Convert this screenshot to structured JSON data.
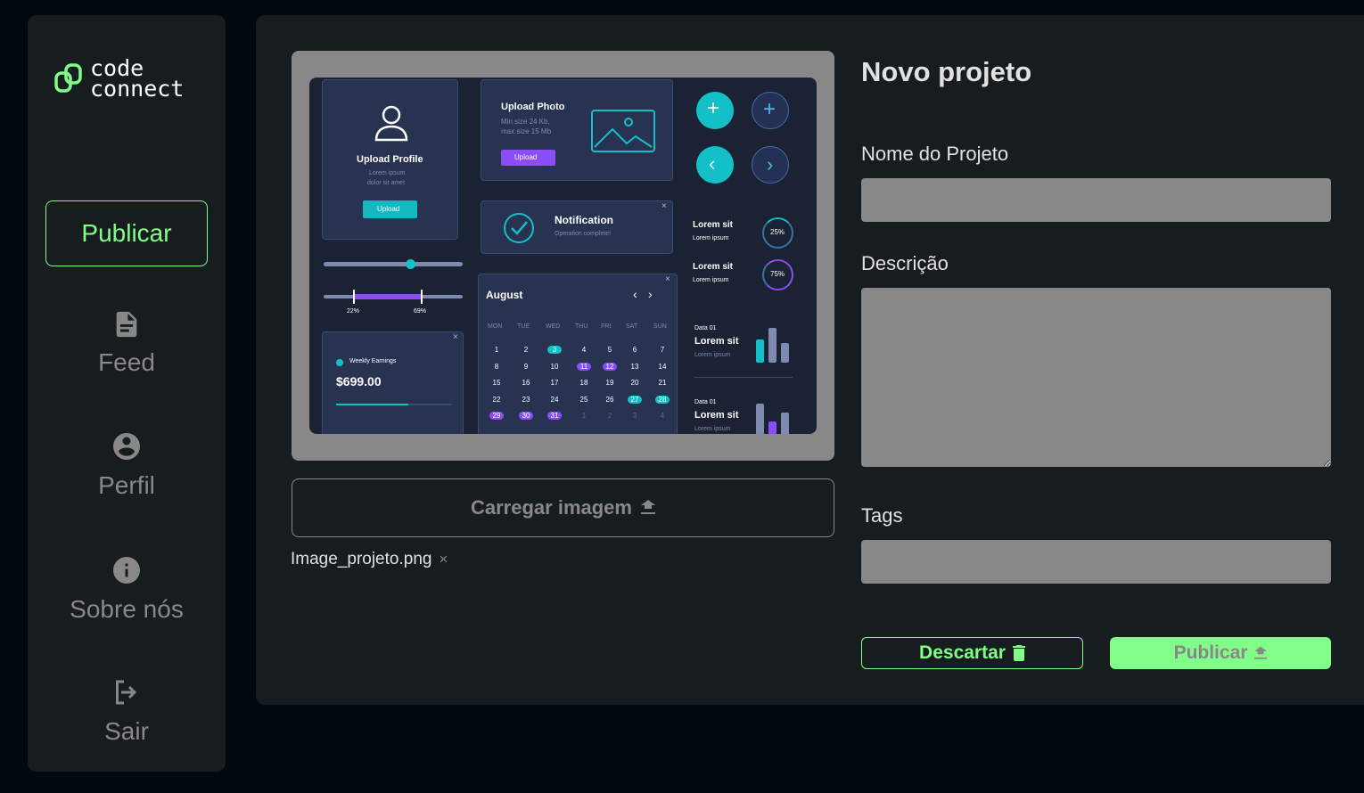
{
  "sidebar": {
    "logo": {
      "line1": "code",
      "line2": "connect"
    },
    "publish_label": "Publicar",
    "items": [
      {
        "label": "Feed",
        "icon": "document-icon"
      },
      {
        "label": "Perfil",
        "icon": "account-icon"
      },
      {
        "label": "Sobre nós",
        "icon": "info-icon"
      },
      {
        "label": "Sair",
        "icon": "logout-icon"
      }
    ]
  },
  "upload": {
    "button_label": "Carregar imagem",
    "file_name": "Image_projeto.png",
    "remove_symbol": "×"
  },
  "preview": {
    "upload_profile": {
      "title": "Upload Profile",
      "sub1": "Lorem ipsum",
      "sub2": "dolor sit amet",
      "button": "Upload"
    },
    "upload_photo": {
      "title": "Upload Photo",
      "sub1": "Min size 24 Kb,",
      "sub2": "max size 15 Mb",
      "button": "Upload"
    },
    "notification": {
      "title": "Notification",
      "sub": "Operation complete!"
    },
    "slider_labels": [
      "22%",
      "69%"
    ],
    "earnings": {
      "label": "Weekly Earnings",
      "value": "$699.00"
    },
    "calendar": {
      "month": "August",
      "days": [
        "MON",
        "TUE",
        "WED",
        "THU",
        "FRI",
        "SAT",
        "SUN"
      ],
      "weeks": [
        [
          "1",
          "2",
          "3",
          "4",
          "5",
          "6",
          "7"
        ],
        [
          "8",
          "9",
          "10",
          "11",
          "12",
          "13",
          "14"
        ],
        [
          "15",
          "16",
          "17",
          "18",
          "19",
          "20",
          "21"
        ],
        [
          "22",
          "23",
          "24",
          "25",
          "26",
          "27",
          "28"
        ],
        [
          "29",
          "30",
          "31",
          "1",
          "2",
          "3",
          "4"
        ]
      ]
    },
    "stats": [
      {
        "title": "Lorem sit",
        "sub": "Lorem ipsum",
        "pct": "25%"
      },
      {
        "title": "Lorem sit",
        "sub": "Lorem ipsum",
        "pct": "75%"
      }
    ],
    "data_cards": [
      {
        "label": "Data 01",
        "title": "Lorem sit",
        "sub": "Lorem ipsum"
      },
      {
        "label": "Data 01",
        "title": "Lorem sit",
        "sub": "Lorem ipsum"
      }
    ]
  },
  "form": {
    "title": "Novo projeto",
    "name_label": "Nome do Projeto",
    "name_value": "",
    "description_label": "Descrição",
    "description_value": "",
    "tags_label": "Tags",
    "tags_value": "",
    "discard_label": "Descartar",
    "publish_label": "Publicar"
  },
  "colors": {
    "background": "#01080E",
    "panel": "#171D1F",
    "accent": "#81FE88",
    "muted": "#888888",
    "text": "#E1E1E1"
  }
}
